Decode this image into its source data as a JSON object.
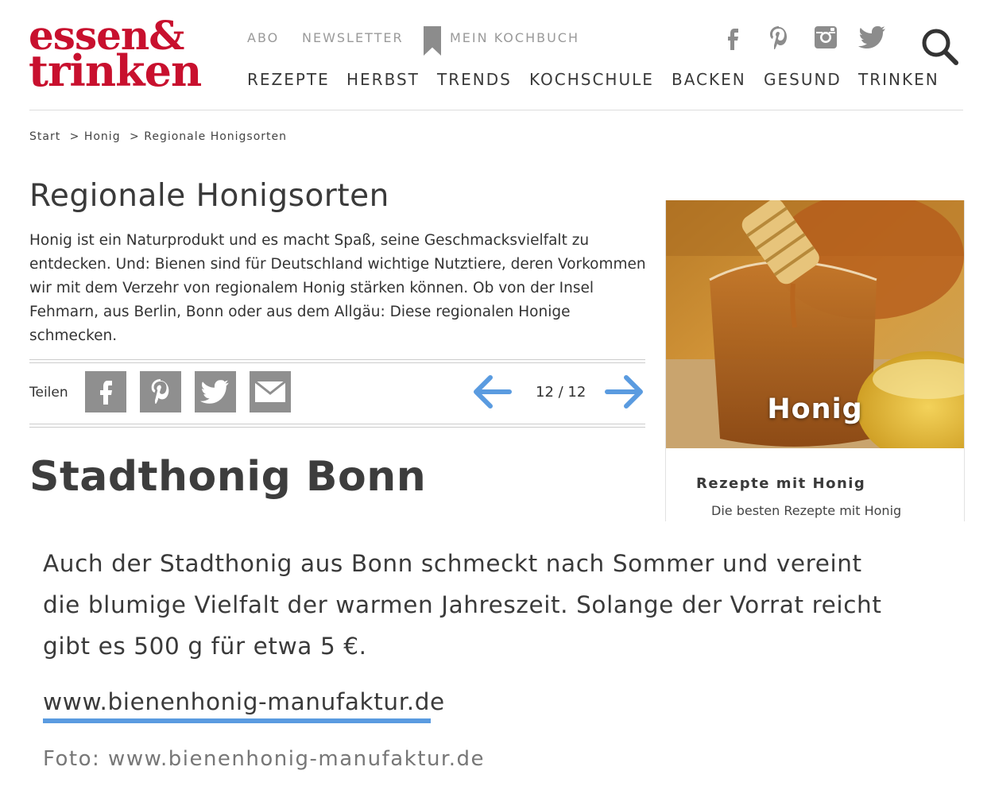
{
  "logo": {
    "line1": "essen&",
    "line2": "trinken"
  },
  "top_nav": {
    "abo": "ABO",
    "newsletter": "NEWSLETTER",
    "kochbuch": "MEIN KOCHBUCH"
  },
  "main_nav": [
    "REZEPTE",
    "HERBST",
    "TRENDS",
    "KOCHSCHULE",
    "BACKEN",
    "GESUND",
    "TRINKEN"
  ],
  "social_icons": [
    "facebook-icon",
    "pinterest-icon",
    "instagram-icon",
    "twitter-icon"
  ],
  "breadcrumb": {
    "start": "Start",
    "sep1": ">",
    "honig": "Honig",
    "sep2": ">",
    "current": "Regionale Honigsorten"
  },
  "article": {
    "title": "Regionale Honigsorten",
    "intro": "Honig ist ein Naturprodukt und es macht Spaß, seine Geschmacksvielfalt zu entdecken. Und: Bienen sind für Deutschland wichtige Nutztiere, deren Vorkommen wir mit dem Verzehr von regionalem Honig stärken können. Ob von der Insel Fehmarn, aus Berlin, Bonn oder aus dem Allgäu: Diese regionalen Honige schmecken."
  },
  "share": {
    "label": "Teilen",
    "buttons": [
      "facebook-icon",
      "pinterest-icon",
      "twitter-icon",
      "mail-icon"
    ]
  },
  "pager": {
    "current": "12",
    "total": "12",
    "text": "12 / 12"
  },
  "slide": {
    "heading": "Stadthonig Bonn",
    "body": "Auch der Stadthonig aus Bonn schmeckt nach Sommer und vereint die blumige Vielfalt der warmen Jahreszeit. Solange der Vorrat reicht gibt es 500 g für etwa 5 €.",
    "link": "www.bienenhonig-manufaktur.de",
    "photo_credit": "Foto:  www.bienenhonig-manufaktur.de"
  },
  "teaser": {
    "label": "Honig",
    "heading": "Rezepte mit Honig",
    "subtext": "Die besten Rezepte mit Honig"
  },
  "colors": {
    "brand": "#c8102e",
    "arrow": "#5a9be0",
    "share_button": "#8f8f8f"
  }
}
